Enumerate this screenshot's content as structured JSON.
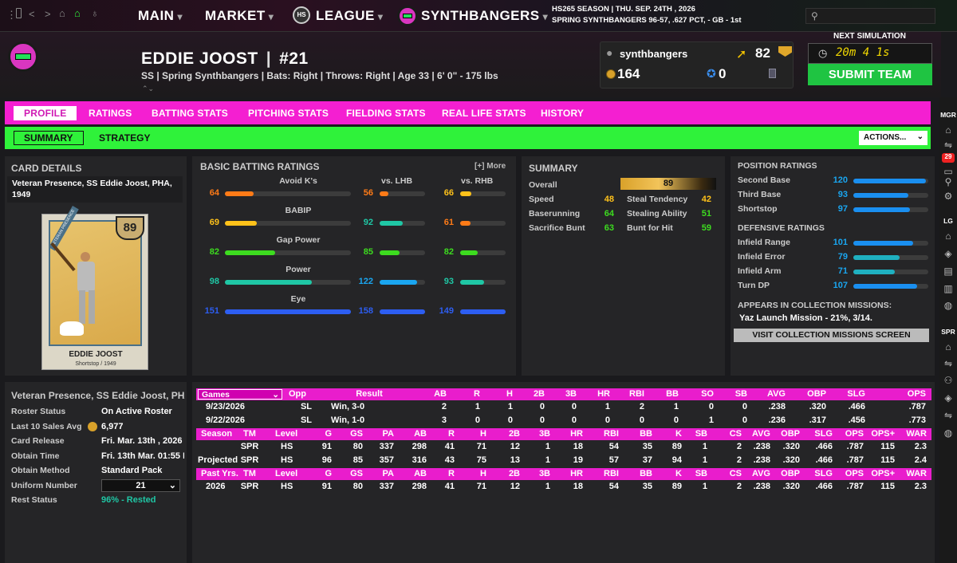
{
  "topbar": {
    "nav": [
      {
        "label": "MAIN"
      },
      {
        "label": "MARKET"
      },
      {
        "label": "LEAGUE",
        "badge": "HS"
      },
      {
        "label": "SYNTHBANGERS"
      }
    ],
    "season_line1": "HS265 SEASON  |  THU. SEP. 24TH , 2026",
    "season_line2": "SPRING SYNTHBANGERS   96-57, .627 PCT, - GB - 1st"
  },
  "player": {
    "name": "EDDIE JOOST",
    "number": "#21",
    "meta": "SS | Spring Synthbangers  |  Bats: Right  |  Throws: Right  |  Age 33  |  6' 0\" - 175 lbs"
  },
  "user": {
    "username": "synthbangers",
    "level": "82",
    "coins": "164",
    "stars": "0"
  },
  "simulation": {
    "label": "NEXT SIMULATION",
    "timer": "20m 4 1s",
    "submit": "SUBMIT TEAM"
  },
  "tabs": [
    "PROFILE",
    "RATINGS",
    "BATTING STATS",
    "PITCHING STATS",
    "FIELDING STATS",
    "REAL LIFE STATS",
    "HISTORY"
  ],
  "subtabs": [
    "SUMMARY",
    "STRATEGY"
  ],
  "actions_label": "ACTIONS...",
  "card": {
    "title": "CARD DETAILS",
    "desc": "Veteran Presence, SS Eddie Joost, PHA, 1949",
    "rating": "89",
    "banner": "VETERAN PRESENCE",
    "card_name": "EDDIE JOOST",
    "card_sub": "Shortstop / 1949"
  },
  "batting": {
    "title": "BASIC BATTING RATINGS",
    "more": "[+] More",
    "col_lhb": "vs. LHB",
    "col_rhb": "vs. RHB",
    "rows": [
      {
        "name": "Avoid K's",
        "ovr": "64",
        "lhb": "56",
        "rhb": "66",
        "ovr_pct": 0.23,
        "lhb_pct": 0.2,
        "rhb_pct": 0.24,
        "ovr_c": "#ff7b17",
        "lhb_c": "#ff7b17",
        "rhb_c": "#ffc21a"
      },
      {
        "name": "BABIP",
        "ovr": "69",
        "lhb": "92",
        "rhb": "61",
        "ovr_pct": 0.25,
        "lhb_pct": 0.5,
        "rhb_pct": 0.22,
        "ovr_c": "#ffc21a",
        "lhb_c": "#1fc7a5",
        "rhb_c": "#ff7b17"
      },
      {
        "name": "Gap Power",
        "ovr": "82",
        "lhb": "85",
        "rhb": "82",
        "ovr_pct": 0.4,
        "lhb_pct": 0.44,
        "rhb_pct": 0.38,
        "ovr_c": "#3ddc1f",
        "lhb_c": "#3ddc1f",
        "rhb_c": "#3ddc1f"
      },
      {
        "name": "Power",
        "ovr": "98",
        "lhb": "122",
        "rhb": "93",
        "ovr_pct": 0.69,
        "lhb_pct": 0.82,
        "rhb_pct": 0.52,
        "ovr_c": "#1fc7a5",
        "lhb_c": "#1aa6f0",
        "rhb_c": "#1fc7a5"
      },
      {
        "name": "Eye",
        "ovr": "151",
        "lhb": "158",
        "rhb": "149",
        "ovr_pct": 1.0,
        "lhb_pct": 1.0,
        "rhb_pct": 1.0,
        "ovr_c": "#2d5ef2",
        "lhb_c": "#2d5ef2",
        "rhb_c": "#2d5ef2"
      }
    ]
  },
  "summary": {
    "title": "SUMMARY",
    "overall_label": "Overall",
    "overall": "89",
    "left": [
      {
        "label": "Speed",
        "value": "48",
        "color": "#ffc21a"
      },
      {
        "label": "Baserunning",
        "value": "64",
        "color": "#3ddc1f"
      },
      {
        "label": "Sacrifice Bunt",
        "value": "63",
        "color": "#3ddc1f"
      }
    ],
    "right": [
      {
        "label": "Steal Tendency",
        "value": "42",
        "color": "#ffc21a"
      },
      {
        "label": "Stealing Ability",
        "value": "51",
        "color": "#3ddc1f"
      },
      {
        "label": "Bunt for Hit",
        "value": "59",
        "color": "#3ddc1f"
      }
    ]
  },
  "positions": {
    "title": "POSITION RATINGS",
    "rows": [
      {
        "label": "Second Base",
        "value": "120",
        "pct": 0.97
      },
      {
        "label": "Third Base",
        "value": "93",
        "pct": 0.73
      },
      {
        "label": "Shortstop",
        "value": "97",
        "pct": 0.76
      }
    ],
    "def_title": "DEFENSIVE RATINGS",
    "def_rows": [
      {
        "label": "Infield Range",
        "value": "101",
        "pct": 0.8
      },
      {
        "label": "Infield Error",
        "value": "79",
        "pct": 0.62
      },
      {
        "label": "Infield Arm",
        "value": "71",
        "pct": 0.55
      },
      {
        "label": "Turn DP",
        "value": "107",
        "pct": 0.85
      }
    ],
    "missions_title": "APPEARS IN COLLECTION MISSIONS:",
    "mission": "Yaz Launch Mission - 21%, 3/14.",
    "missions_button": "VISIT COLLECTION MISSIONS SCREEN"
  },
  "details": {
    "title": "Veteran Presence, SS Eddie Joost, PHA,",
    "rows": [
      {
        "label": "Roster Status",
        "value": "On Active Roster"
      },
      {
        "label": "Last 10 Sales Avg",
        "value": "6,977"
      },
      {
        "label": "Card Release",
        "value": "Fri. Mar. 13th , 2026"
      },
      {
        "label": "Obtain Time",
        "value": "Fri. 13th Mar. 01:55 I"
      },
      {
        "label": "Obtain Method",
        "value": "Standard Pack"
      },
      {
        "label": "Uniform Number",
        "value": "21"
      },
      {
        "label": "Rest Status",
        "value": "96% - Rested"
      }
    ]
  },
  "games": {
    "select": "Games",
    "headers": [
      "Opp",
      "Result",
      "AB",
      "R",
      "H",
      "2B",
      "3B",
      "HR",
      "RBI",
      "BB",
      "SO",
      "SB",
      "AVG",
      "OBP",
      "SLG",
      "OPS"
    ],
    "rows": [
      [
        "9/23/2026",
        "SL",
        "Win, 3-0",
        "2",
        "1",
        "1",
        "0",
        "0",
        "1",
        "2",
        "1",
        "0",
        "0",
        ".238",
        ".320",
        ".466",
        ".787"
      ],
      [
        "9/22/2026",
        "SL",
        "Win, 1-0",
        "3",
        "0",
        "0",
        "0",
        "0",
        "0",
        "0",
        "0",
        "1",
        "0",
        ".236",
        ".317",
        ".456",
        ".773"
      ]
    ]
  },
  "season": {
    "headers": [
      "Season",
      "TM",
      "Level",
      "G",
      "GS",
      "PA",
      "AB",
      "R",
      "H",
      "2B",
      "3B",
      "HR",
      "RBI",
      "BB",
      "K",
      "SB",
      "CS",
      "AVG",
      "OBP",
      "SLG",
      "OPS",
      "OPS+",
      "WAR"
    ],
    "rows": [
      [
        "",
        "SPR",
        "HS",
        "91",
        "80",
        "337",
        "298",
        "41",
        "71",
        "12",
        "1",
        "18",
        "54",
        "35",
        "89",
        "1",
        "2",
        ".238",
        ".320",
        ".466",
        ".787",
        "115",
        "2.3"
      ],
      [
        "Projected",
        "SPR",
        "HS",
        "96",
        "85",
        "357",
        "316",
        "43",
        "75",
        "13",
        "1",
        "19",
        "57",
        "37",
        "94",
        "1",
        "2",
        ".238",
        ".320",
        ".466",
        ".787",
        "115",
        "2.4"
      ]
    ]
  },
  "past": {
    "headers": [
      "Past Yrs.",
      "TM",
      "Level",
      "G",
      "GS",
      "PA",
      "AB",
      "R",
      "H",
      "2B",
      "3B",
      "HR",
      "RBI",
      "BB",
      "K",
      "SB",
      "CS",
      "AVG",
      "OBP",
      "SLG",
      "OPS",
      "OPS+",
      "WAR"
    ],
    "rows": [
      [
        "2026",
        "SPR",
        "HS",
        "91",
        "80",
        "337",
        "298",
        "41",
        "71",
        "12",
        "1",
        "18",
        "54",
        "35",
        "89",
        "1",
        "2",
        ".238",
        ".320",
        ".466",
        ".787",
        "115",
        "2.3"
      ]
    ]
  },
  "rail": {
    "mgr": "MGR",
    "badge": "29",
    "lg": "LG",
    "spr": "SPR"
  },
  "colors": {
    "magenta": "#f41fd1",
    "green": "#2ff23a",
    "submit": "#1fc442"
  }
}
